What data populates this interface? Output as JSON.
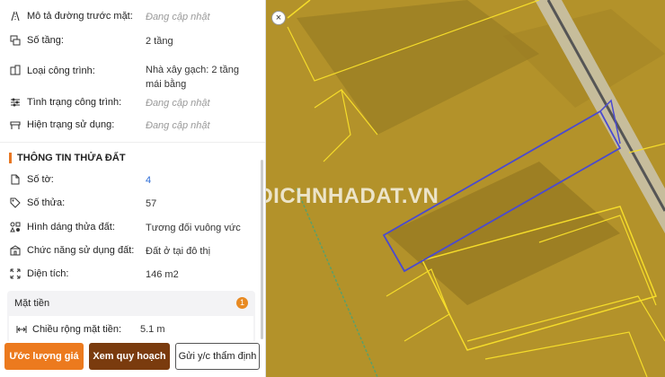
{
  "top_rows": [
    {
      "icon": "road-icon",
      "label": "Mô tả đường trước mặt:",
      "value": "Đang cập nhật",
      "pending": true
    },
    {
      "icon": "floors-icon",
      "label": "Số tầng:",
      "value": "2 tầng",
      "pending": false
    },
    {
      "icon": "building-icon",
      "label": "Loại công trình:",
      "value": "Nhà xây gạch: 2 tầng mái bằng",
      "pending": false
    },
    {
      "icon": "sliders-icon",
      "label": "Tình trạng công trình:",
      "value": "Đang cập nhật",
      "pending": true
    },
    {
      "icon": "usage-icon",
      "label": "Hiện trạng sử dụng:",
      "value": "Đang cập nhật",
      "pending": true
    }
  ],
  "land_section": {
    "title": "THÔNG TIN THỬA ĐẤT",
    "rows": [
      {
        "icon": "document-icon",
        "label": "Số tờ:",
        "value": "4"
      },
      {
        "icon": "tag-icon",
        "label": "Số thửa:",
        "value": "57"
      },
      {
        "icon": "shape-icon",
        "label": "Hình dáng thửa đất:",
        "value": "Tương đối vuông vức"
      },
      {
        "icon": "function-icon",
        "label": "Chức năng sử dụng đất:",
        "value": "Đất ở tại đô thị"
      },
      {
        "icon": "area-icon",
        "label": "Diện tích:",
        "value": "146 m2"
      }
    ]
  },
  "frontage": {
    "title": "Mặt tiền",
    "badge": "1",
    "label": "Chiều rộng mặt tiền:",
    "value": "5.1 m"
  },
  "buttons": {
    "estimate": "Ước lượng giá",
    "plan": "Xem quy hoạch",
    "request": "Gửi y/c thẩm định"
  },
  "close_symbol": "×",
  "watermark": "GIAODICHNHADAT.VN",
  "colors": {
    "accent": "#ec7a1e",
    "plan_button": "#7a3b0e",
    "map_overlay": "#b89623",
    "parcel_outline": "#4a4ad0"
  }
}
